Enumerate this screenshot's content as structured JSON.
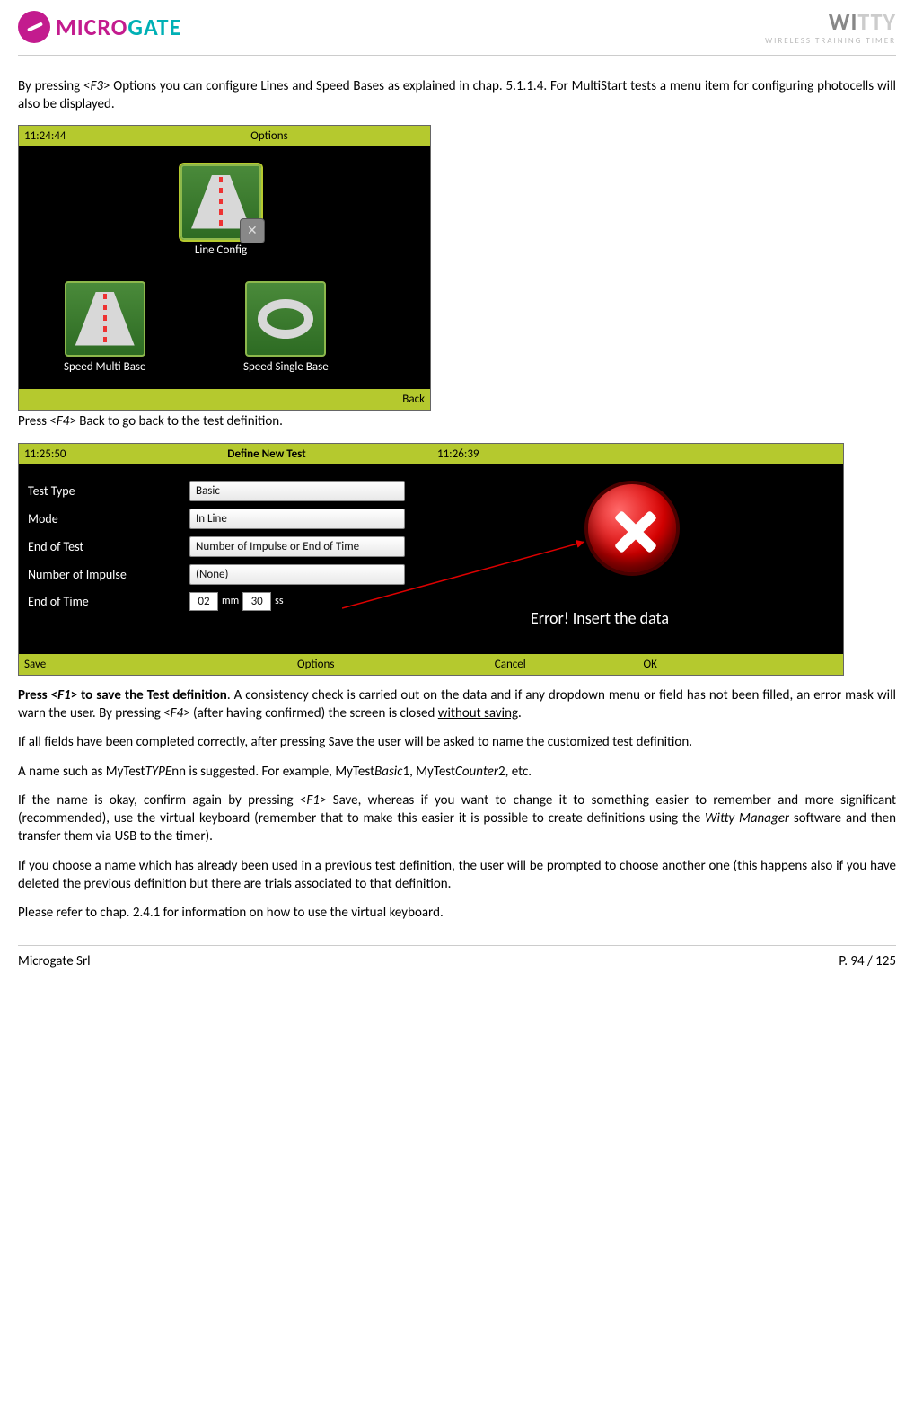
{
  "header": {
    "logo_left_a": "MICRO",
    "logo_left_b": "GATE",
    "logo_right_a": "WI",
    "logo_right_b": "TTY",
    "logo_right_sub": "WIRELESS TRAINING TIMER"
  },
  "p1": {
    "a": "By pressing <",
    "b": "F3",
    "c": "> Options you can configure Lines and Speed Bases as explained in chap. 5.1.1.4. For MultiStart tests a menu item for configuring photocells will also be displayed."
  },
  "shot1": {
    "time": "11:24:44",
    "title": "Options",
    "tiles": {
      "line": "Line Config",
      "multi": "Speed Multi Base",
      "single": "Speed Single Base"
    },
    "back": "Back"
  },
  "p2": {
    "a": "Press <",
    "b": "F4",
    "c": "> Back to go back to the test definition."
  },
  "shot2": {
    "time1": "11:25:50",
    "title": "Define  New  Test",
    "time2": "11:26:39",
    "rows": {
      "test_type": {
        "label": "Test Type",
        "value": "Basic"
      },
      "mode": {
        "label": "Mode",
        "value": "In Line"
      },
      "end_test": {
        "label": "End of Test",
        "value": "Number of Impulse or End of Time"
      },
      "num_imp": {
        "label": "Number of Impulse",
        "value": "(None)"
      },
      "end_time": {
        "label": "End of Time",
        "mm": "02",
        "mm_lbl": "mm",
        "ss": "30",
        "ss_lbl": "ss"
      }
    },
    "error": "Error! Insert the data",
    "buttons": {
      "save": "Save",
      "options": "Options",
      "cancel": "Cancel",
      "ok": "OK"
    }
  },
  "p3": {
    "a": "Press <",
    "b": "F1",
    "c": "> to save the Test definition",
    "d": ". A consistency check is carried out on the data and if any dropdown menu or field has not been filled, an error mask will warn the user. By pressing <",
    "e": "F4",
    "f": "> (after having confirmed) the screen is closed ",
    "g": "without saving",
    "h": "."
  },
  "p4": "If all fields have been completed correctly, after pressing Save the user will be asked to name the customized test definition.",
  "p5": {
    "a": "A name such as MyTest",
    "b": "TYPE",
    "c": "nn is suggested. For example, MyTest",
    "d": "Basic",
    "e": "1, MyTest",
    "f": "Counter",
    "g": "2, etc."
  },
  "p6": {
    "a": "If the name is okay, confirm again by pressing <",
    "b": "F1",
    "c": "> Save, whereas if you want to change it to something easier to remember and more significant (recommended), use the virtual keyboard (remember that to make this easier it is possible to create definitions using the ",
    "d": "Witty Manager",
    "e": " software and then transfer them via USB to the timer)."
  },
  "p7": "If you choose a name which has already been used in a previous test definition, the user will be prompted to choose another one (this happens also if you have deleted the previous definition but there are trials associated to that definition.",
  "p8": "Please refer to chap. 2.4.1 for information on how to use the virtual keyboard.",
  "footer": {
    "left": "Microgate Srl",
    "right": "P. 94 / 125"
  }
}
